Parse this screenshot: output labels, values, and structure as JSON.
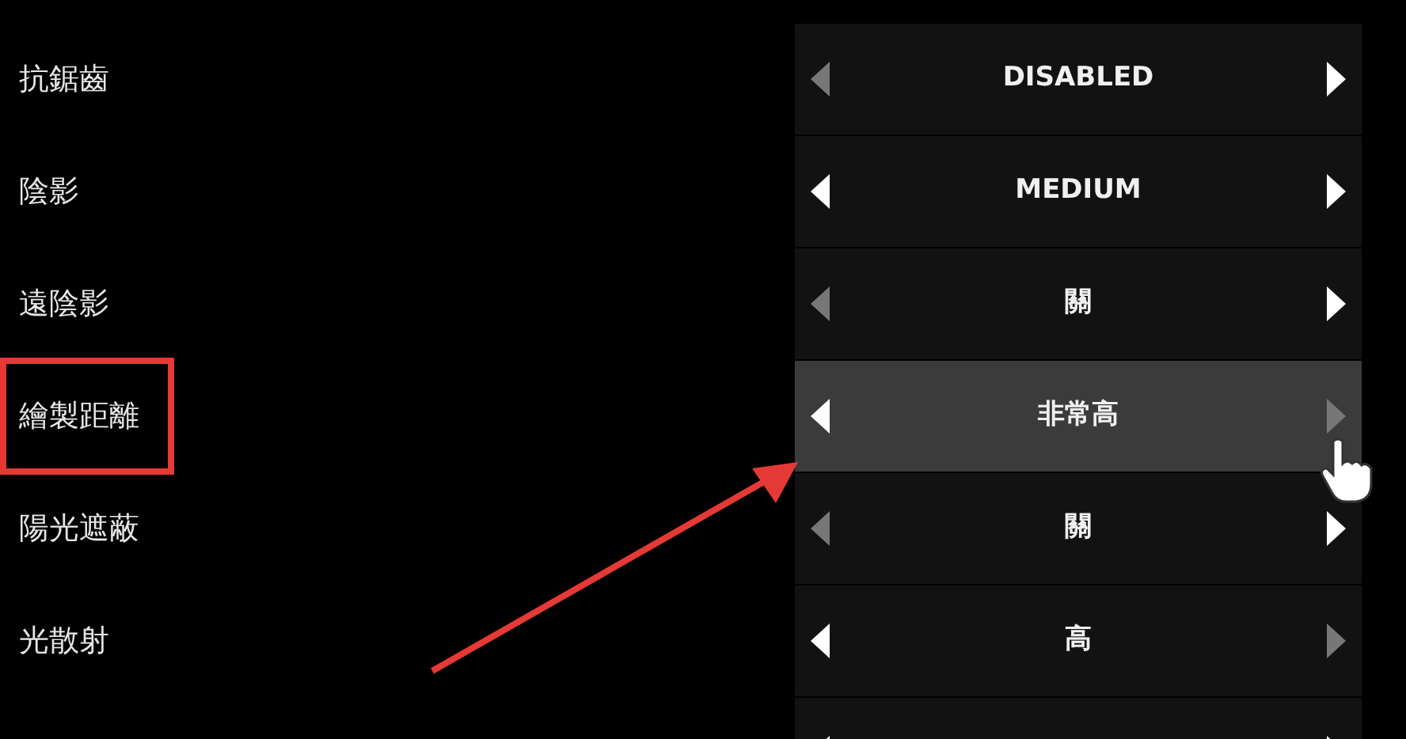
{
  "settings": [
    {
      "label": "抗鋸齒",
      "value": "DISABLED",
      "left_enabled": false,
      "right_enabled": true,
      "selected": false
    },
    {
      "label": "陰影",
      "value": "MEDIUM",
      "left_enabled": true,
      "right_enabled": true,
      "selected": false
    },
    {
      "label": "遠陰影",
      "value": "關",
      "left_enabled": false,
      "right_enabled": true,
      "selected": false
    },
    {
      "label": "繪製距離",
      "value": "非常高",
      "left_enabled": true,
      "right_enabled": false,
      "selected": true
    },
    {
      "label": "陽光遮蔽",
      "value": "關",
      "left_enabled": false,
      "right_enabled": true,
      "selected": false
    },
    {
      "label": "光散射",
      "value": "高",
      "left_enabled": true,
      "right_enabled": false,
      "selected": false
    },
    {
      "left_enabled": true,
      "right_enabled": true,
      "selected": false
    }
  ]
}
